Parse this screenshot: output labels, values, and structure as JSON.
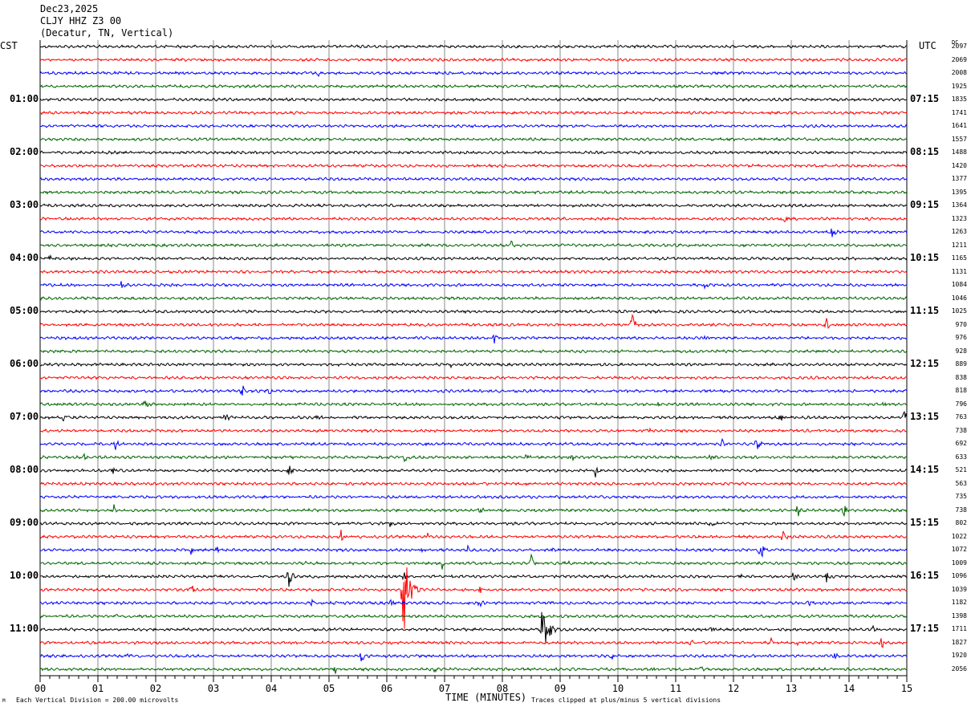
{
  "header": {
    "date": "Dec23,2025",
    "station": "CLJY HHZ Z3 00",
    "location": "(Decatur, TN, Vertical)"
  },
  "left_axis_title": "CST",
  "right_axis_title": "UTC",
  "dc_title": "DC",
  "left_hour_labels": [
    "01:00",
    "02:00",
    "03:00",
    "04:00",
    "05:00",
    "06:00",
    "07:00",
    "08:00",
    "09:00",
    "10:00",
    "11:00"
  ],
  "right_hour_labels": [
    "07:15",
    "08:15",
    "09:15",
    "10:15",
    "11:15",
    "12:15",
    "13:15",
    "14:15",
    "15:15",
    "16:15",
    "17:15"
  ],
  "dc_offsets": [
    "2097",
    "2069",
    "2008",
    "1925",
    "1835",
    "1741",
    "1641",
    "1557",
    "1488",
    "1420",
    "1377",
    "1395",
    "1364",
    "1323",
    "1263",
    "1211",
    "1165",
    "1131",
    "1084",
    "1046",
    "1025",
    "970",
    "976",
    "928",
    "889",
    "838",
    "818",
    "796",
    "763",
    "738",
    "692",
    "633",
    "521",
    "563",
    "735",
    "738",
    "802",
    "1022",
    "1072",
    "1009",
    "1096",
    "1039",
    "1182",
    "1398",
    "1711",
    "1827",
    "1920",
    "2056"
  ],
  "footer": {
    "scale_note": "Each Vertical Division =  200.00 microvolts",
    "clip_note": "Traces clipped at plus/minus 5 vertical divisions",
    "corner_mark": "M"
  },
  "chart_data": {
    "type": "line",
    "xlabel": "TIME (MINUTES)",
    "x_ticks": [
      "00",
      "01",
      "02",
      "03",
      "04",
      "05",
      "06",
      "07",
      "08",
      "09",
      "10",
      "11",
      "12",
      "13",
      "14",
      "15"
    ],
    "xlim": [
      0,
      15
    ],
    "trace_count": 48,
    "trace_minutes": 15,
    "trace_colors": [
      "#000000",
      "#ff0000",
      "#0000ff",
      "#006400"
    ],
    "grid": true,
    "clip_divisions": 5,
    "events": [
      {
        "trace": 2,
        "minute": 4.8,
        "amp": 0.3
      },
      {
        "trace": 8,
        "minute": 3.5,
        "amp": 0.25
      },
      {
        "trace": 13,
        "minute": 12.85,
        "amp": 0.6
      },
      {
        "trace": 14,
        "minute": 13.7,
        "amp": 1.0
      },
      {
        "trace": 15,
        "minute": 8.15,
        "amp": 0.4
      },
      {
        "trace": 16,
        "minute": 0.15,
        "amp": 0.35
      },
      {
        "trace": 17,
        "minute": 6.9,
        "amp": 0.3
      },
      {
        "trace": 18,
        "minute": 1.4,
        "amp": 0.45
      },
      {
        "trace": 18,
        "minute": 11.5,
        "amp": 0.4
      },
      {
        "trace": 21,
        "minute": 10.25,
        "amp": 1.2
      },
      {
        "trace": 21,
        "minute": 13.6,
        "amp": 0.8
      },
      {
        "trace": 22,
        "minute": 7.85,
        "amp": 0.8
      },
      {
        "trace": 22,
        "minute": 11.5,
        "amp": 0.3
      },
      {
        "trace": 24,
        "minute": 7.1,
        "amp": 0.35
      },
      {
        "trace": 26,
        "minute": 3.5,
        "amp": 0.5
      },
      {
        "trace": 26,
        "minute": 3.95,
        "amp": 0.4
      },
      {
        "trace": 27,
        "minute": 1.8,
        "amp": 0.7
      },
      {
        "trace": 27,
        "minute": 14.6,
        "amp": 0.4
      },
      {
        "trace": 27,
        "minute": 10.7,
        "amp": 0.25
      },
      {
        "trace": 28,
        "minute": 0.4,
        "amp": 0.6
      },
      {
        "trace": 28,
        "minute": 3.2,
        "amp": 0.5
      },
      {
        "trace": 28,
        "minute": 4.8,
        "amp": 0.3
      },
      {
        "trace": 28,
        "minute": 12.8,
        "amp": 0.45
      },
      {
        "trace": 28,
        "minute": 14.95,
        "amp": 1.0
      },
      {
        "trace": 29,
        "minute": 10.5,
        "amp": 0.25
      },
      {
        "trace": 30,
        "minute": 1.3,
        "amp": 0.5
      },
      {
        "trace": 30,
        "minute": 6.7,
        "amp": 0.5
      },
      {
        "trace": 30,
        "minute": 11.8,
        "amp": 0.4
      },
      {
        "trace": 30,
        "minute": 12.4,
        "amp": 0.7
      },
      {
        "trace": 31,
        "minute": 0.75,
        "amp": 0.3
      },
      {
        "trace": 31,
        "minute": 6.3,
        "amp": 0.35
      },
      {
        "trace": 31,
        "minute": 8.4,
        "amp": 0.4
      },
      {
        "trace": 31,
        "minute": 9.2,
        "amp": 0.4
      },
      {
        "trace": 31,
        "minute": 11.6,
        "amp": 0.35
      },
      {
        "trace": 31,
        "minute": 13.6,
        "amp": 0.3
      },
      {
        "trace": 32,
        "minute": 1.25,
        "amp": 0.5
      },
      {
        "trace": 32,
        "minute": 4.3,
        "amp": 0.5
      },
      {
        "trace": 32,
        "minute": 9.6,
        "amp": 0.8
      },
      {
        "trace": 35,
        "minute": 1.27,
        "amp": 0.6
      },
      {
        "trace": 35,
        "minute": 7.6,
        "amp": 0.35
      },
      {
        "trace": 35,
        "minute": 13.1,
        "amp": 0.9
      },
      {
        "trace": 35,
        "minute": 13.9,
        "amp": 0.7
      },
      {
        "trace": 36,
        "minute": 11.6,
        "amp": 0.5
      },
      {
        "trace": 36,
        "minute": 6.05,
        "amp": 0.25
      },
      {
        "trace": 37,
        "minute": 5.2,
        "amp": 0.6
      },
      {
        "trace": 37,
        "minute": 6.7,
        "amp": 0.4
      },
      {
        "trace": 37,
        "minute": 12.85,
        "amp": 0.7
      },
      {
        "trace": 38,
        "minute": 2.6,
        "amp": 0.5
      },
      {
        "trace": 38,
        "minute": 3.05,
        "amp": 0.4
      },
      {
        "trace": 38,
        "minute": 6.6,
        "amp": 0.45
      },
      {
        "trace": 38,
        "minute": 7.4,
        "amp": 0.3
      },
      {
        "trace": 38,
        "minute": 8.85,
        "amp": 0.3
      },
      {
        "trace": 38,
        "minute": 12.45,
        "amp": 1.5
      },
      {
        "trace": 39,
        "minute": 6.95,
        "amp": 0.6
      },
      {
        "trace": 39,
        "minute": 8.5,
        "amp": 0.7
      },
      {
        "trace": 39,
        "minute": 4.6,
        "amp": 0.3
      },
      {
        "trace": 39,
        "minute": 9.1,
        "amp": 0.3
      },
      {
        "trace": 40,
        "minute": 4.3,
        "amp": 1.2
      },
      {
        "trace": 40,
        "minute": 6.3,
        "amp": 0.5
      },
      {
        "trace": 40,
        "minute": 7.1,
        "amp": 0.3
      },
      {
        "trace": 40,
        "minute": 13.05,
        "amp": 0.7
      },
      {
        "trace": 40,
        "minute": 13.6,
        "amp": 0.8
      },
      {
        "trace": 40,
        "minute": 12.1,
        "amp": 0.3
      },
      {
        "trace": 41,
        "minute": 2.6,
        "amp": 0.8
      },
      {
        "trace": 41,
        "minute": 6.27,
        "amp": 5.0
      },
      {
        "trace": 41,
        "minute": 7.6,
        "amp": 0.4
      },
      {
        "trace": 41,
        "minute": 12.3,
        "amp": 0.3
      },
      {
        "trace": 42,
        "minute": 4.7,
        "amp": 0.3
      },
      {
        "trace": 42,
        "minute": 6.05,
        "amp": 0.6
      },
      {
        "trace": 42,
        "minute": 7.6,
        "amp": 0.6
      },
      {
        "trace": 42,
        "minute": 8.85,
        "amp": 0.4
      },
      {
        "trace": 42,
        "minute": 13.3,
        "amp": 0.3
      },
      {
        "trace": 43,
        "minute": 1.3,
        "amp": 0.3
      },
      {
        "trace": 44,
        "minute": 8.68,
        "amp": 2.5
      },
      {
        "trace": 44,
        "minute": 11.6,
        "amp": 0.35
      },
      {
        "trace": 44,
        "minute": 14.4,
        "amp": 0.35
      },
      {
        "trace": 45,
        "minute": 6.05,
        "amp": 0.3
      },
      {
        "trace": 45,
        "minute": 11.25,
        "amp": 0.4
      },
      {
        "trace": 45,
        "minute": 12.65,
        "amp": 0.4
      },
      {
        "trace": 45,
        "minute": 13.1,
        "amp": 0.3
      },
      {
        "trace": 45,
        "minute": 14.55,
        "amp": 1.2
      },
      {
        "trace": 46,
        "minute": 1.5,
        "amp": 0.4
      },
      {
        "trace": 46,
        "minute": 5.55,
        "amp": 0.6
      },
      {
        "trace": 46,
        "minute": 9.9,
        "amp": 0.4
      },
      {
        "trace": 46,
        "minute": 13.75,
        "amp": 0.35
      },
      {
        "trace": 47,
        "minute": 5.1,
        "amp": 0.5
      },
      {
        "trace": 47,
        "minute": 6.8,
        "amp": 0.3
      },
      {
        "trace": 47,
        "minute": 10.6,
        "amp": 0.35
      },
      {
        "trace": 47,
        "minute": 11.4,
        "amp": 0.5
      }
    ]
  }
}
